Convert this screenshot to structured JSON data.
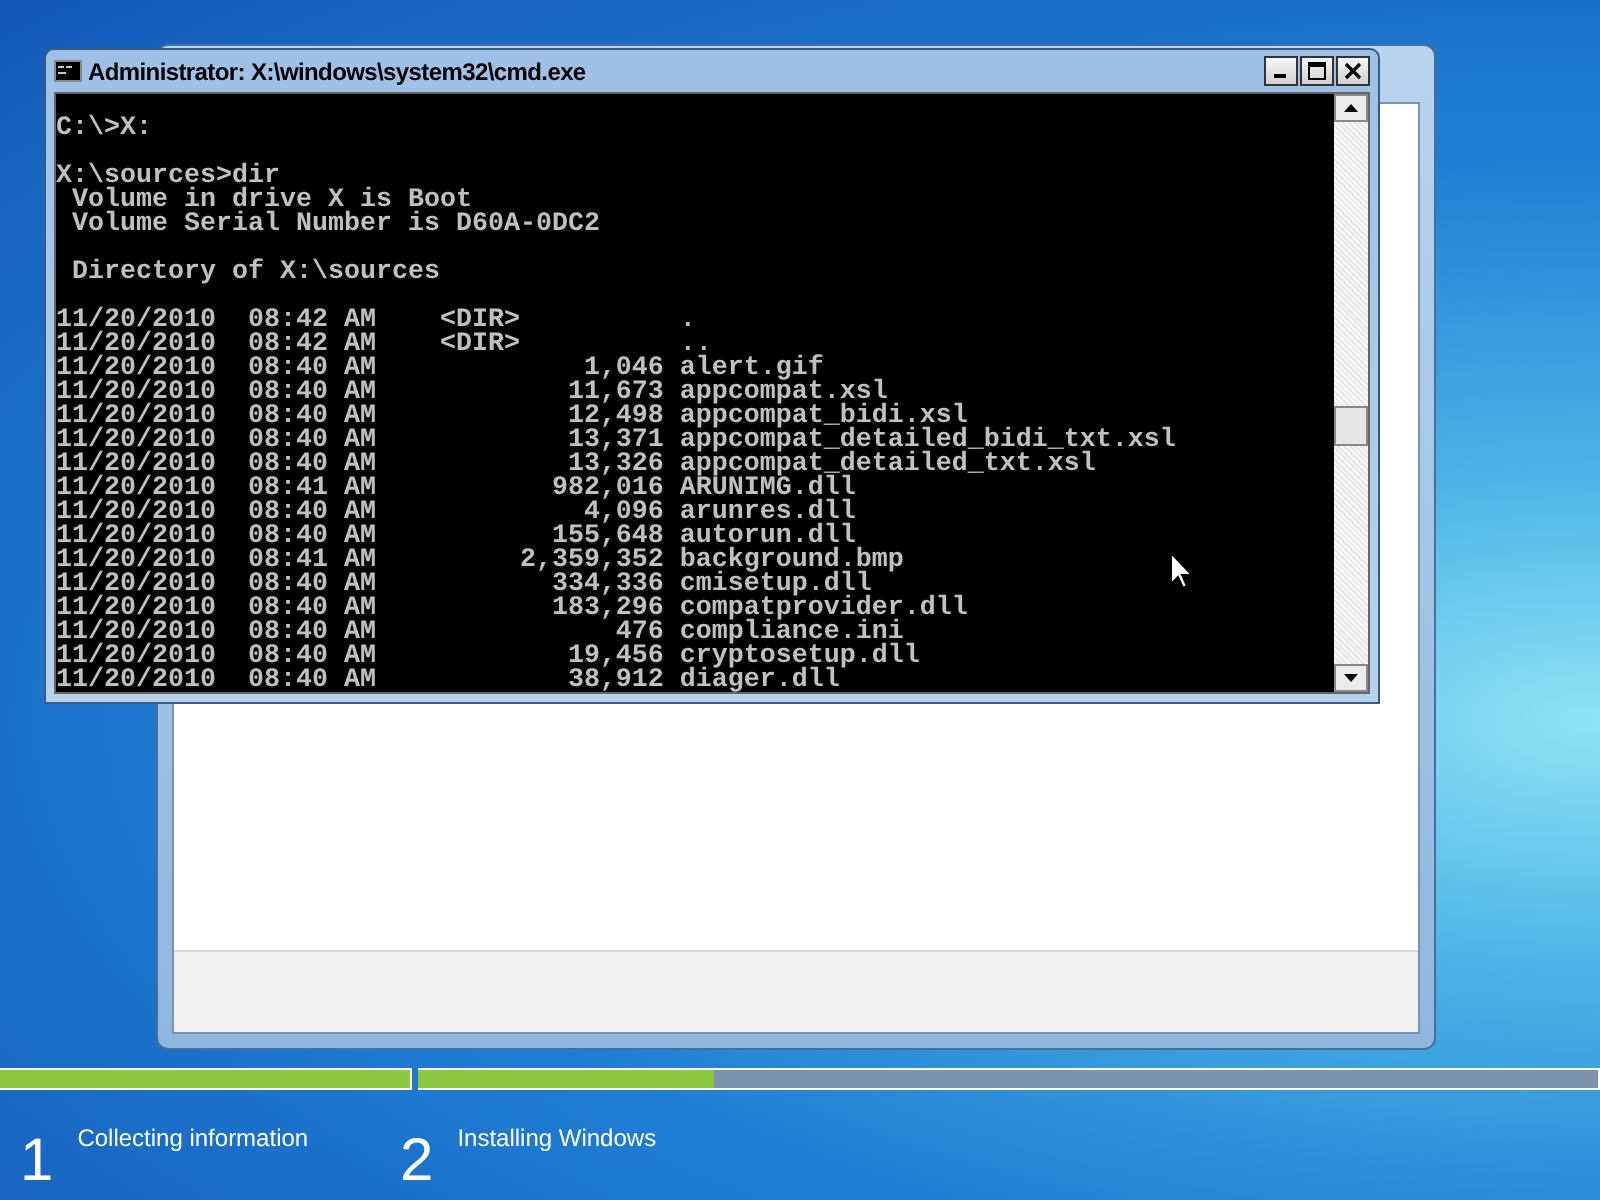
{
  "console_window": {
    "title": "Administrator: X:\\windows\\system32\\cmd.exe",
    "lines": [
      {
        "text": "C:\\>X:",
        "gap_before": true
      },
      {
        "text": "X:\\sources>dir",
        "gap_before": true
      },
      {
        "text": " Volume in drive X is Boot",
        "gap_before": false
      },
      {
        "text": " Volume Serial Number is D60A-0DC2",
        "gap_before": false
      },
      {
        "text": " Directory of X:\\sources",
        "gap_before": true
      },
      {
        "text": "11/20/2010  08:42 AM    <DIR>          .",
        "gap_before": true
      },
      {
        "text": "11/20/2010  08:42 AM    <DIR>          ..",
        "gap_before": false
      },
      {
        "text": "11/20/2010  08:40 AM             1,046 alert.gif",
        "gap_before": false
      },
      {
        "text": "11/20/2010  08:40 AM            11,673 appcompat.xsl",
        "gap_before": false
      },
      {
        "text": "11/20/2010  08:40 AM            12,498 appcompat_bidi.xsl",
        "gap_before": false
      },
      {
        "text": "11/20/2010  08:40 AM            13,371 appcompat_detailed_bidi_txt.xsl",
        "gap_before": false
      },
      {
        "text": "11/20/2010  08:40 AM            13,326 appcompat_detailed_txt.xsl",
        "gap_before": false
      },
      {
        "text": "11/20/2010  08:41 AM           982,016 ARUNIMG.dll",
        "gap_before": false
      },
      {
        "text": "11/20/2010  08:40 AM             4,096 arunres.dll",
        "gap_before": false
      },
      {
        "text": "11/20/2010  08:40 AM           155,648 autorun.dll",
        "gap_before": false
      },
      {
        "text": "11/20/2010  08:41 AM         2,359,352 background.bmp",
        "gap_before": false
      },
      {
        "text": "11/20/2010  08:40 AM           334,336 cmisetup.dll",
        "gap_before": false
      },
      {
        "text": "11/20/2010  08:40 AM           183,296 compatprovider.dll",
        "gap_before": false
      },
      {
        "text": "11/20/2010  08:40 AM               476 compliance.ini",
        "gap_before": false
      },
      {
        "text": "11/20/2010  08:40 AM            19,456 cryptosetup.dll",
        "gap_before": false
      },
      {
        "text": "11/20/2010  08:40 AM            38,912 diager.dll",
        "gap_before": false
      }
    ]
  },
  "setup_steps": [
    {
      "number": "1",
      "label": "Collecting information",
      "level": 1
    },
    {
      "number": "2",
      "label": "Installing Windows",
      "level": 0.25
    }
  ]
}
